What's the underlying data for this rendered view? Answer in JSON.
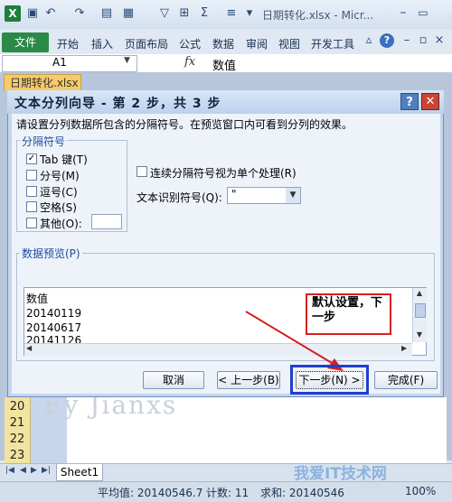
{
  "app": {
    "doc_title": "日期转化.xlsx - Micr...",
    "file_tab": "文件",
    "ribbon_tabs": [
      "开始",
      "插入",
      "页面布局",
      "公式",
      "数据",
      "审阅",
      "视图",
      "开发工具"
    ],
    "workbook_tab": "日期转化.xlsx"
  },
  "formula_bar": {
    "name_box": "A1",
    "fx": "fx",
    "value": "数值"
  },
  "rows": [
    "20",
    "21",
    "22",
    "23"
  ],
  "sheet_tab": "Sheet1",
  "status": {
    "average": "平均值: 20140546.7",
    "count": "计数: 11",
    "sum": "求和: 20140546",
    "zoom": "100%"
  },
  "dialog": {
    "title": "文本分列向导 - 第 2 步，共 3 步",
    "help": "?",
    "close": "✕",
    "instruction": "请设置分列数据所包含的分隔符号。在预览窗口内可看到分列的效果。",
    "separators_legend": "分隔符号",
    "separators": [
      {
        "label": "Tab 键(T)",
        "checked": true
      },
      {
        "label": "分号(M)",
        "checked": false
      },
      {
        "label": "逗号(C)",
        "checked": false
      },
      {
        "label": "空格(S)",
        "checked": false
      },
      {
        "label": "其他(O):",
        "checked": false
      }
    ],
    "consecutive_label": "连续分隔符号视为单个处理(R)",
    "qualifier_label": "文本识别符号(Q):",
    "qualifier_value": "\"",
    "preview_legend": "数据预览(P)",
    "preview_lines": [
      "数值",
      "20140119",
      "20140617",
      "20141126"
    ],
    "buttons": {
      "cancel": "取消",
      "back": "< 上一步(B)",
      "next": "下一步(N) >",
      "finish": "完成(F)"
    }
  },
  "annotation": {
    "text": "默认设置，下一步",
    "color": "#d42020"
  },
  "watermark": "我爱IT技术网"
}
